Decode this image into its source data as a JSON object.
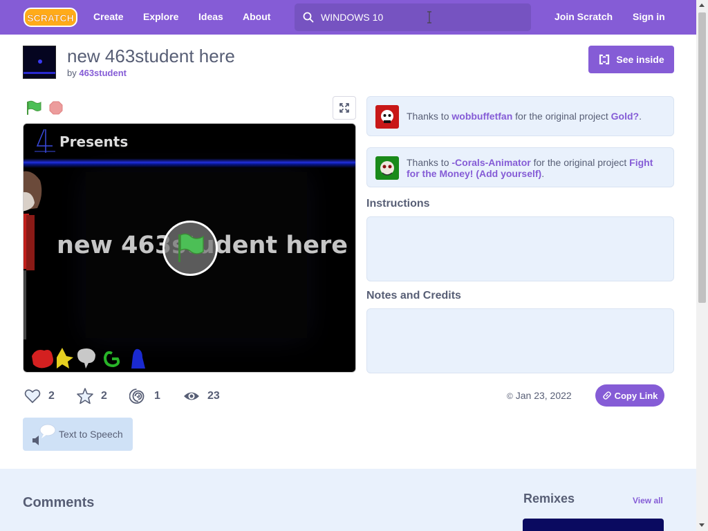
{
  "nav": {
    "logo_text": "SCRATCH",
    "create": "Create",
    "explore": "Explore",
    "ideas": "Ideas",
    "about": "About",
    "search_value": "WINDOWS 10",
    "join": "Join Scratch",
    "signin": "Sign in"
  },
  "project": {
    "title": "new 463student here",
    "by_label": "by",
    "author": "463student",
    "see_inside": "See inside"
  },
  "stage": {
    "presents": "Presents",
    "overlay_text": "new 463student here"
  },
  "remix_notes": [
    {
      "prefix": "Thanks to",
      "user": "wobbuffetfan",
      "middle": "for the original project",
      "project": "Gold?",
      "suffix": "."
    },
    {
      "prefix": "Thanks to",
      "user": "-Corals-Animator",
      "middle": "for the original project",
      "project": "Fight for the Money! (Add yourself)",
      "suffix": "."
    }
  ],
  "sections": {
    "instructions": "Instructions",
    "notes": "Notes and Credits"
  },
  "stats": {
    "loves": "2",
    "favorites": "2",
    "remixes": "1",
    "views": "23",
    "date": "Jan 23, 2022",
    "copy_link": "Copy Link"
  },
  "tts_label": "Text to Speech",
  "bottom": {
    "comments": "Comments",
    "remixes": "Remixes",
    "view_all": "View all"
  },
  "colors": {
    "brand": "#855cd6",
    "panel": "#e9f1fc",
    "text": "#575e75"
  }
}
